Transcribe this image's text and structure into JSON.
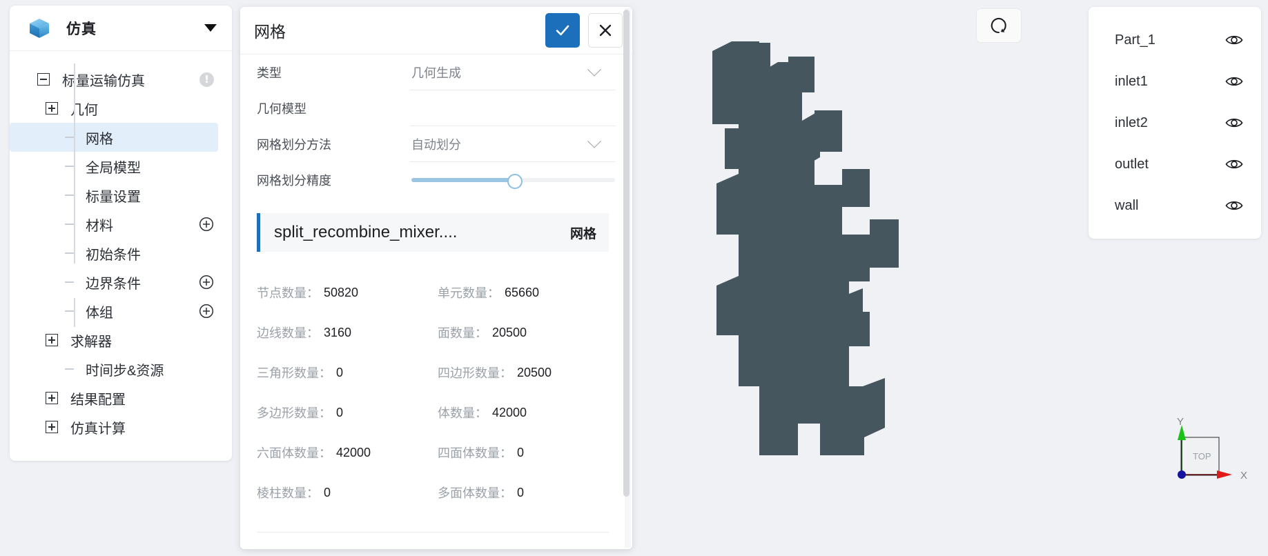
{
  "app": {
    "title": "仿真",
    "logo_icon": "cube-icon",
    "collapse_icon": "caret-down-icon"
  },
  "sidebar": {
    "tree": [
      {
        "label": "标量运输仿真",
        "level": 0,
        "toggle": "minus",
        "badge": "!",
        "selected": false
      },
      {
        "label": "几何",
        "level": 1,
        "toggle": "plus",
        "selected": false
      },
      {
        "label": "网格",
        "level": 2,
        "toggle": "none",
        "selected": true
      },
      {
        "label": "全局模型",
        "level": 2,
        "toggle": "none",
        "selected": false
      },
      {
        "label": "标量设置",
        "level": 2,
        "toggle": "none",
        "selected": false
      },
      {
        "label": "材料",
        "level": 2,
        "toggle": "none",
        "action": "add-icon",
        "selected": false
      },
      {
        "label": "初始条件",
        "level": 2,
        "toggle": "none",
        "selected": false
      },
      {
        "label": "边界条件",
        "level": 2,
        "toggle": "none",
        "action": "add-icon",
        "selected": false
      },
      {
        "label": "体组",
        "level": 2,
        "toggle": "none",
        "action": "add-icon",
        "selected": false
      },
      {
        "label": "求解器",
        "level": 1,
        "toggle": "plus",
        "selected": false
      },
      {
        "label": "时间步&资源",
        "level": 2,
        "toggle": "none",
        "selected": false
      },
      {
        "label": "结果配置",
        "level": 1,
        "toggle": "plus",
        "selected": false
      },
      {
        "label": "仿真计算",
        "level": 1,
        "toggle": "plus",
        "selected": false
      }
    ]
  },
  "dialog": {
    "title": "网格",
    "confirm_icon": "check-icon",
    "cancel_icon": "close-icon",
    "fields": [
      {
        "label": "类型",
        "value": "几何生成",
        "has_chevron": true
      },
      {
        "label": "几何模型",
        "value": "",
        "has_chevron": false
      },
      {
        "label": "网格划分方法",
        "value": "自动划分",
        "has_chevron": true
      }
    ],
    "slider": {
      "label": "网格划分精度",
      "percent": 50
    },
    "mesh_card": {
      "name": "split_recombine_mixer....",
      "tag": "网格",
      "accent": "#1c6fba"
    },
    "stats": [
      {
        "label": "节点数量：",
        "value": "50820"
      },
      {
        "label": "单元数量：",
        "value": "65660"
      },
      {
        "label": "边线数量：",
        "value": "3160"
      },
      {
        "label": "面数量：",
        "value": "20500"
      },
      {
        "label": "三角形数量：",
        "value": "0"
      },
      {
        "label": "四边形数量：",
        "value": "20500"
      },
      {
        "label": "多边形数量：",
        "value": "0"
      },
      {
        "label": "体数量：",
        "value": "42000"
      },
      {
        "label": "六面体数量：",
        "value": "42000"
      },
      {
        "label": "四面体数量：",
        "value": "0"
      },
      {
        "label": "棱柱数量：",
        "value": "0"
      },
      {
        "label": "多面体数量：",
        "value": "0"
      }
    ]
  },
  "viewport": {
    "reset_icon": "reset-view-icon",
    "model_color": "#46565e",
    "background": "#eff1f5",
    "parts": [
      {
        "name": "Part_1",
        "visibility_icon": "eye-icon"
      },
      {
        "name": "inlet1",
        "visibility_icon": "eye-icon"
      },
      {
        "name": "inlet2",
        "visibility_icon": "eye-icon"
      },
      {
        "name": "outlet",
        "visibility_icon": "eye-icon"
      },
      {
        "name": "wall",
        "visibility_icon": "eye-icon"
      }
    ],
    "axis_triad": {
      "x_label": "X",
      "y_label": "Y",
      "face_label": "TOP",
      "x_color": "#e01b1b",
      "y_color": "#19c219"
    }
  }
}
